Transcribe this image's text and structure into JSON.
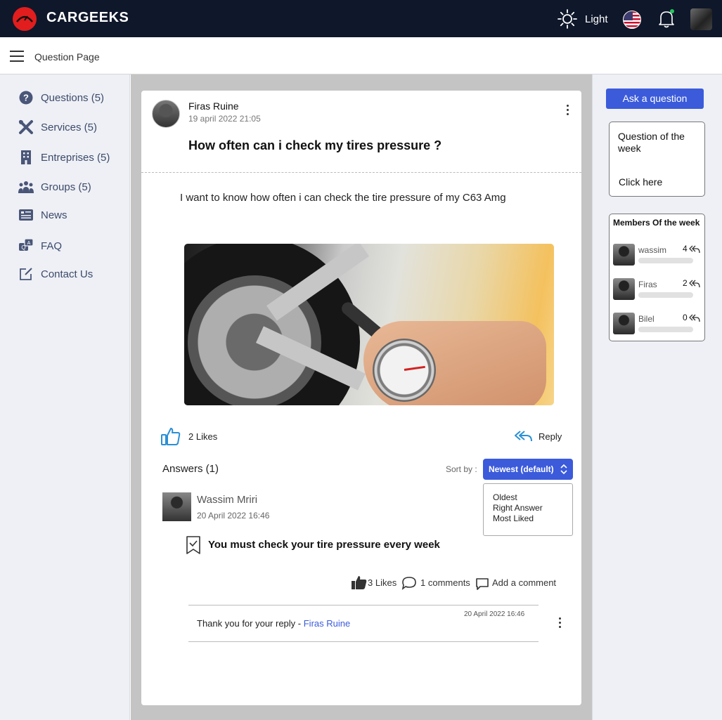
{
  "header": {
    "brand": "CARGEEKS",
    "theme_label": "Light"
  },
  "subheader": {
    "title": "Question Page"
  },
  "sidebar": {
    "items": [
      {
        "label": "Questions (5)",
        "icon": "question-circle-icon"
      },
      {
        "label": "Services (5)",
        "icon": "tools-icon"
      },
      {
        "label": "Entreprises (5)",
        "icon": "building-icon"
      },
      {
        "label": "Groups (5)",
        "icon": "group-icon"
      },
      {
        "label": "News",
        "icon": "newspaper-icon"
      },
      {
        "label": "FAQ",
        "icon": "faq-icon"
      },
      {
        "label": "Contact Us",
        "icon": "edit-square-icon"
      }
    ]
  },
  "question": {
    "author": "Firas Ruine",
    "date": "19 april 2022 21:05",
    "title": "How often can i check my tires pressure ?",
    "body": "I want to know how often i can check the tire pressure of my C63 Amg",
    "likes": "2 Likes",
    "reply_label": "Reply"
  },
  "answers": {
    "title": "Answers (1)",
    "sort_label": "Sort by :",
    "sort_selected": "Newest (default)",
    "sort_options": [
      "Oldest",
      "Right Answer",
      "Most Liked"
    ],
    "items": [
      {
        "author": "Wassim Mriri",
        "date": "20 April 2022 16:46",
        "text": "You must check your tire pressure every week",
        "likes": "3 Likes",
        "comments": "1 comments",
        "add_comment": "Add a comment",
        "comment": {
          "date": "20 April 2022 16:46",
          "text": "Thank you for your reply - ",
          "author": "Firas Ruine"
        }
      }
    ]
  },
  "rightbar": {
    "ask_button": "Ask a question",
    "qotw_title": "Question of the week",
    "qotw_link": "Click here",
    "members_title": "Members Of the week",
    "members": [
      {
        "name": "wassim",
        "score": "4"
      },
      {
        "name": "Firas",
        "score": "2"
      },
      {
        "name": "Bilel",
        "score": "0"
      }
    ]
  },
  "colors": {
    "topbar": "#0f172a",
    "accent": "#3b5bdb",
    "logo": "#e11d1d"
  }
}
